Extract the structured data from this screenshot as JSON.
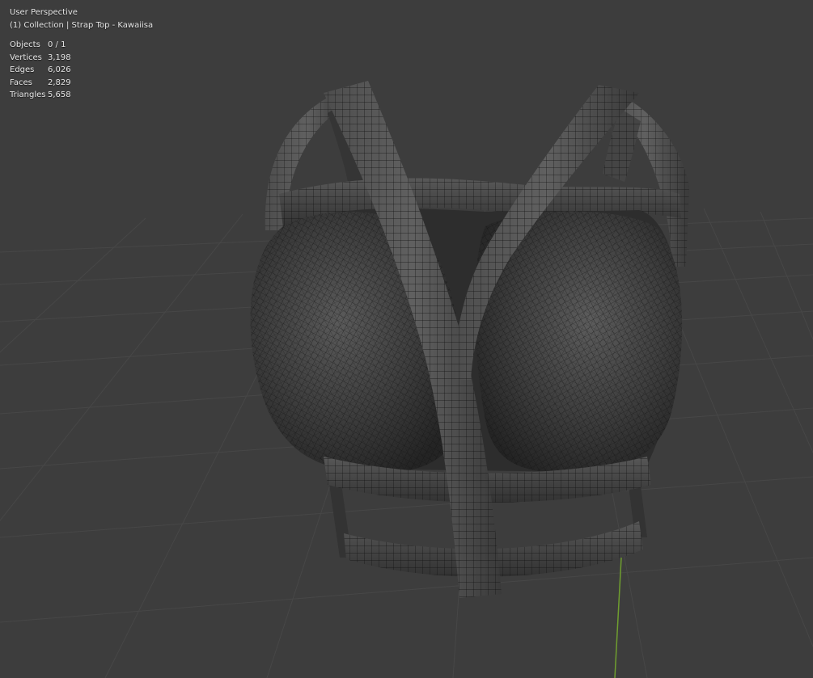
{
  "viewport": {
    "view_name": "User Perspective",
    "collection_line": "(1) Collection | Strap Top - Kawaiisa",
    "stats": [
      {
        "label": "Objects",
        "value": "0 / 1"
      },
      {
        "label": "Vertices",
        "value": "3,198"
      },
      {
        "label": "Edges",
        "value": "6,026"
      },
      {
        "label": "Faces",
        "value": "2,829"
      },
      {
        "label": "Triangles",
        "value": "5,658"
      }
    ]
  },
  "colors": {
    "background": "#3d3d3d",
    "grid_line": "#474747",
    "y_axis": "#6f9e2f",
    "mesh_surface": "#3a3a3a",
    "mesh_wire": "#151515",
    "overlay_text": "#e6e6e6"
  },
  "icons": {
    "model": "strap-top-mesh"
  }
}
